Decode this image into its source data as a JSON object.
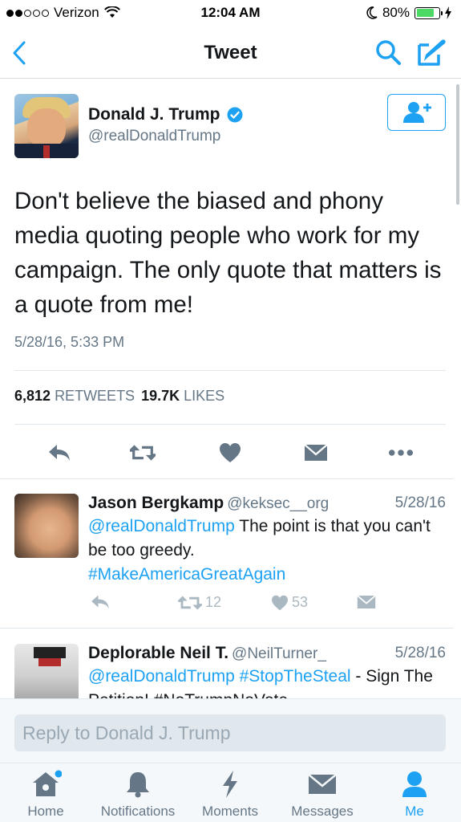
{
  "status_bar": {
    "carrier": "Verizon",
    "time": "12:04 AM",
    "battery": "80%",
    "battery_level": 0.8
  },
  "nav": {
    "title": "Tweet",
    "back_icon": "chevron-left-icon",
    "search_icon": "search-icon",
    "compose_icon": "compose-icon"
  },
  "tweet": {
    "author_name": "Donald J. Trump",
    "author_handle": "@realDonaldTrump",
    "text": "Don't believe the biased and phony media quoting people who work for my campaign. The only quote that matters is a quote from me!",
    "timestamp": "5/28/16, 5:33 PM",
    "retweet_count": "6,812",
    "retweet_label": "RETWEETS",
    "like_count": "19.7K",
    "like_label": "LIKES"
  },
  "replies": [
    {
      "name": "Jason Bergkamp",
      "handle": "@keksec__org",
      "date": "5/28/16",
      "mention": "@realDonaldTrump",
      "text": " The point is that you can't be too greedy.",
      "hashtag": "#MakeAmericaGreatAgain",
      "retweets": "12",
      "likes": "53"
    },
    {
      "name": "Deplorable Neil T.",
      "handle": "@NeilTurner_",
      "date": "5/28/16",
      "mention": "@realDonaldTrump",
      "hashtag": "#StopTheSteal",
      "text": " - Sign The Petition! #NoTrumpNoVote"
    }
  ],
  "reply_bar": {
    "placeholder": "Reply to Donald J. Trump"
  },
  "tabs": [
    {
      "label": "Home",
      "icon": "home-icon"
    },
    {
      "label": "Notifications",
      "icon": "bell-icon"
    },
    {
      "label": "Moments",
      "icon": "lightning-icon"
    },
    {
      "label": "Messages",
      "icon": "envelope-icon"
    },
    {
      "label": "Me",
      "icon": "person-icon",
      "active": true
    }
  ],
  "colors": {
    "accent": "#1da1f2",
    "text": "#14171a",
    "secondary": "#657786",
    "action_gray": "#657786"
  }
}
